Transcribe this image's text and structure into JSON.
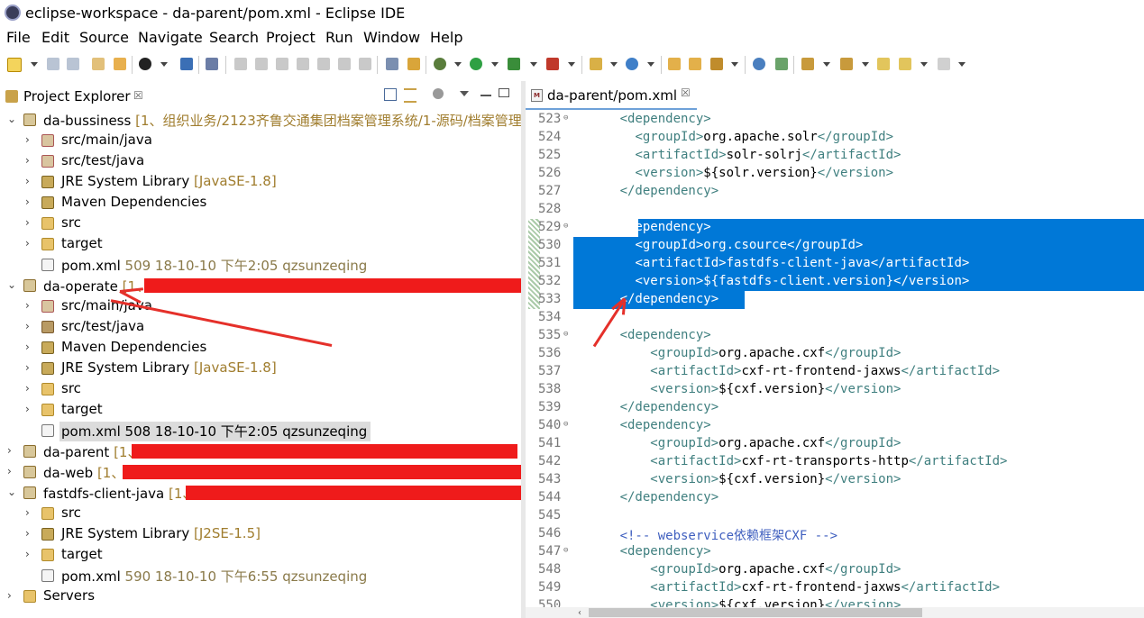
{
  "window": {
    "title": "eclipse-workspace - da-parent/pom.xml - Eclipse IDE"
  },
  "menu": [
    "File",
    "Edit",
    "Source",
    "Navigate",
    "Search",
    "Project",
    "Run",
    "Window",
    "Help"
  ],
  "explorer": {
    "tab_label": "Project Explorer",
    "close_glyph": "☒",
    "tree": [
      {
        "id": "da-bussiness",
        "label": "da-bussiness",
        "deco": "[1、组织业务/2123齐鲁交通集团档案管理系统/1-源码/档案管理"
      },
      {
        "id": "src-main-java-1",
        "label": "src/main/java"
      },
      {
        "id": "src-test-java-1",
        "label": "src/test/java"
      },
      {
        "id": "jre-1",
        "label": "JRE System Library",
        "deco": "[JavaSE-1.8]"
      },
      {
        "id": "maven-1",
        "label": "Maven Dependencies"
      },
      {
        "id": "src-1",
        "label": "src"
      },
      {
        "id": "target-1",
        "label": "target"
      },
      {
        "id": "pom-1",
        "label": "pom.xml",
        "meta": "509  18-10-10 下午2:05  qzsunzeqing"
      },
      {
        "id": "da-operate",
        "label": "da-operate",
        "deco": "[1、"
      },
      {
        "id": "src-main-java-2",
        "label": "src/main/java"
      },
      {
        "id": "src-test-java-2",
        "label": "src/test/java"
      },
      {
        "id": "maven-2",
        "label": "Maven Dependencies"
      },
      {
        "id": "jre-2",
        "label": "JRE System Library",
        "deco": "[JavaSE-1.8]"
      },
      {
        "id": "src-2",
        "label": "src"
      },
      {
        "id": "target-2",
        "label": "target"
      },
      {
        "id": "pom-2",
        "label": "pom.xml",
        "meta": "508  18-10-10 下午2:05  qzsunzeqing"
      },
      {
        "id": "da-parent",
        "label": "da-parent",
        "deco": "[1、"
      },
      {
        "id": "da-web",
        "label": "da-web",
        "deco": "[1、"
      },
      {
        "id": "fastdfs",
        "label": "fastdfs-client-java",
        "deco": "[1、"
      },
      {
        "id": "src-3",
        "label": "src"
      },
      {
        "id": "jre-3",
        "label": "JRE System Library",
        "deco": "[J2SE-1.5]"
      },
      {
        "id": "target-3",
        "label": "target"
      },
      {
        "id": "pom-3",
        "label": "pom.xml",
        "meta": "590  18-10-10 下午6:55  qzsunzeqing"
      },
      {
        "id": "servers",
        "label": "Servers"
      }
    ]
  },
  "editor": {
    "tab_label": "da-parent/pom.xml",
    "close_glyph": "☒",
    "lines": [
      {
        "n": "523",
        "fold": true,
        "indent": "      ",
        "text": "<dependency>"
      },
      {
        "n": "524",
        "indent": "        ",
        "text": "<groupId>org.apache.solr</groupId>"
      },
      {
        "n": "525",
        "indent": "        ",
        "text": "<artifactId>solr-solrj</artifactId>"
      },
      {
        "n": "526",
        "indent": "        ",
        "text": "<version>${solr.version}</version>"
      },
      {
        "n": "527",
        "indent": "      ",
        "text": "</dependency>"
      },
      {
        "n": "528",
        "indent": "",
        "text": ""
      },
      {
        "n": "529",
        "fold": true,
        "indent": "      ",
        "text": "<dependency>",
        "sel": true
      },
      {
        "n": "530",
        "indent": "        ",
        "text": "<groupId>org.csource</groupId>",
        "sel": true
      },
      {
        "n": "531",
        "indent": "        ",
        "text": "<artifactId>fastdfs-client-java</artifactId>",
        "sel": true
      },
      {
        "n": "532",
        "indent": "        ",
        "text": "<version>${fastdfs-client.version}</version>",
        "sel": true
      },
      {
        "n": "533",
        "indent": "      ",
        "text": "</dependency>",
        "sel": true
      },
      {
        "n": "534",
        "indent": "",
        "text": ""
      },
      {
        "n": "535",
        "fold": true,
        "indent": "      ",
        "text": "<dependency>"
      },
      {
        "n": "536",
        "indent": "          ",
        "text": "<groupId>org.apache.cxf</groupId>"
      },
      {
        "n": "537",
        "indent": "          ",
        "text": "<artifactId>cxf-rt-frontend-jaxws</artifactId>"
      },
      {
        "n": "538",
        "indent": "          ",
        "text": "<version>${cxf.version}</version>"
      },
      {
        "n": "539",
        "indent": "      ",
        "text": "</dependency>"
      },
      {
        "n": "540",
        "fold": true,
        "indent": "      ",
        "text": "<dependency>"
      },
      {
        "n": "541",
        "indent": "          ",
        "text": "<groupId>org.apache.cxf</groupId>"
      },
      {
        "n": "542",
        "indent": "          ",
        "text": "<artifactId>cxf-rt-transports-http</artifactId>"
      },
      {
        "n": "543",
        "indent": "          ",
        "text": "<version>${cxf.version}</version>"
      },
      {
        "n": "544",
        "indent": "      ",
        "text": "</dependency>"
      },
      {
        "n": "545",
        "indent": "",
        "text": ""
      },
      {
        "n": "546",
        "indent": "      ",
        "text": "<!-- webservice依赖框架CXF -->",
        "comment": true
      },
      {
        "n": "547",
        "fold": true,
        "indent": "      ",
        "text": "<dependency>"
      },
      {
        "n": "548",
        "indent": "          ",
        "text": "<groupId>org.apache.cxf</groupId>"
      },
      {
        "n": "549",
        "indent": "          ",
        "text": "<artifactId>cxf-rt-frontend-jaxws</artifactId>"
      },
      {
        "n": "550",
        "indent": "          ",
        "text": "<version>${cxf.version}</version>"
      }
    ]
  },
  "colors": {
    "selection": "#0078d7",
    "tag": "#3f7f7f",
    "comment": "#3f5fbf",
    "redaction": "#ef1b1b",
    "annotation_arrow": "#e5302a"
  }
}
